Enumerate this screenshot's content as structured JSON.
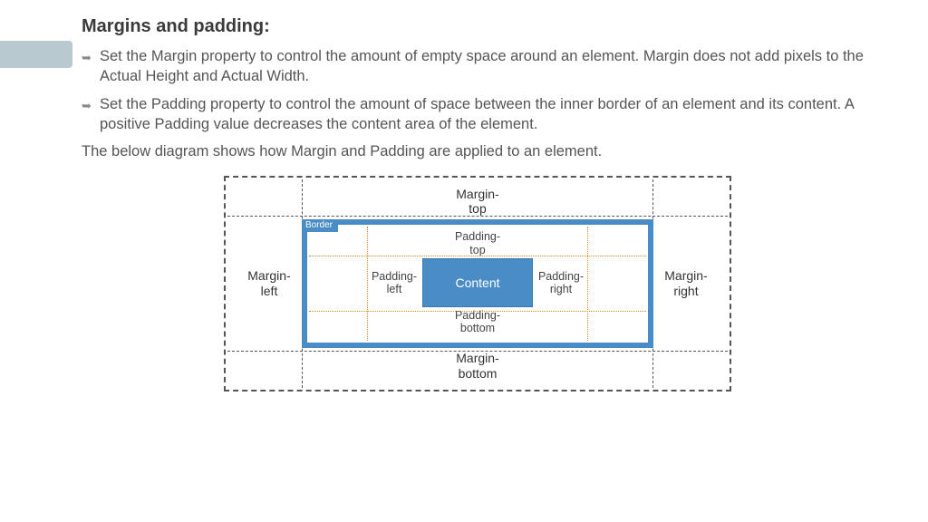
{
  "title": "Margins and padding:",
  "bullets": [
    "Set the Margin property to control the amount of empty space around an element. Margin does not add pixels to the Actual Height and Actual Width.",
    "Set the Padding property to control the amount of space between the inner border of an element and its content. A positive Padding value decreases the content area of the element."
  ],
  "caption": "The below diagram shows how Margin and Padding are applied to an element.",
  "diagram": {
    "border_label": "Border",
    "content_label": "Content",
    "margin": {
      "top": "Margin-\ntop",
      "right": "Margin-\nright",
      "bottom": "Margin-\nbottom",
      "left": "Margin-\nleft"
    },
    "padding": {
      "top": "Padding-\ntop",
      "right": "Padding-\nright",
      "bottom": "Padding-\nbottom",
      "left": "Padding-\nleft"
    }
  }
}
